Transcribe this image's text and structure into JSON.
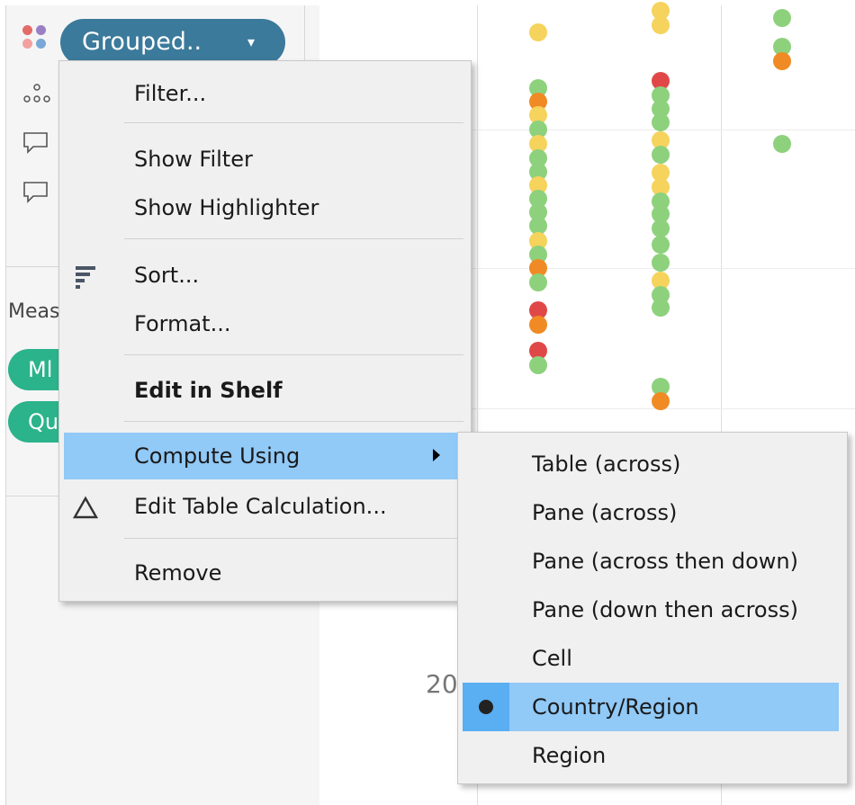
{
  "marks_card": {
    "color_pill_label": "Grouped..",
    "pill_caret": "▾",
    "color_pill_color": "#3b7a9b"
  },
  "data_pane": {
    "measures_label": "Meas",
    "measure_pills": [
      "Ml",
      "Qu"
    ],
    "measure_pill_color": "#2bb38b"
  },
  "viz": {
    "axis_label_partial": "20"
  },
  "context_menu": {
    "items": {
      "filter": "Filter...",
      "show_filter": "Show Filter",
      "show_highlighter": "Show Highlighter",
      "sort": "Sort...",
      "format": "Format...",
      "edit_in_shelf": "Edit in Shelf",
      "compute_using": "Compute Using",
      "edit_table_calc": "Edit Table Calculation...",
      "remove": "Remove"
    },
    "highlight_color": "#91c9f7"
  },
  "compute_using_submenu": {
    "items": [
      {
        "label": "Table (across)",
        "selected": false
      },
      {
        "label": "Pane (across)",
        "selected": false
      },
      {
        "label": "Pane (across then down)",
        "selected": false
      },
      {
        "label": "Pane (down then across)",
        "selected": false
      },
      {
        "label": "Cell",
        "selected": false
      },
      {
        "label": "Country/Region",
        "selected": true
      },
      {
        "label": "Region",
        "selected": false
      }
    ]
  },
  "palette": {
    "green": "#8dd17c",
    "yellow": "#f5d35c",
    "orange": "#f08a24",
    "red": "#e04848"
  }
}
